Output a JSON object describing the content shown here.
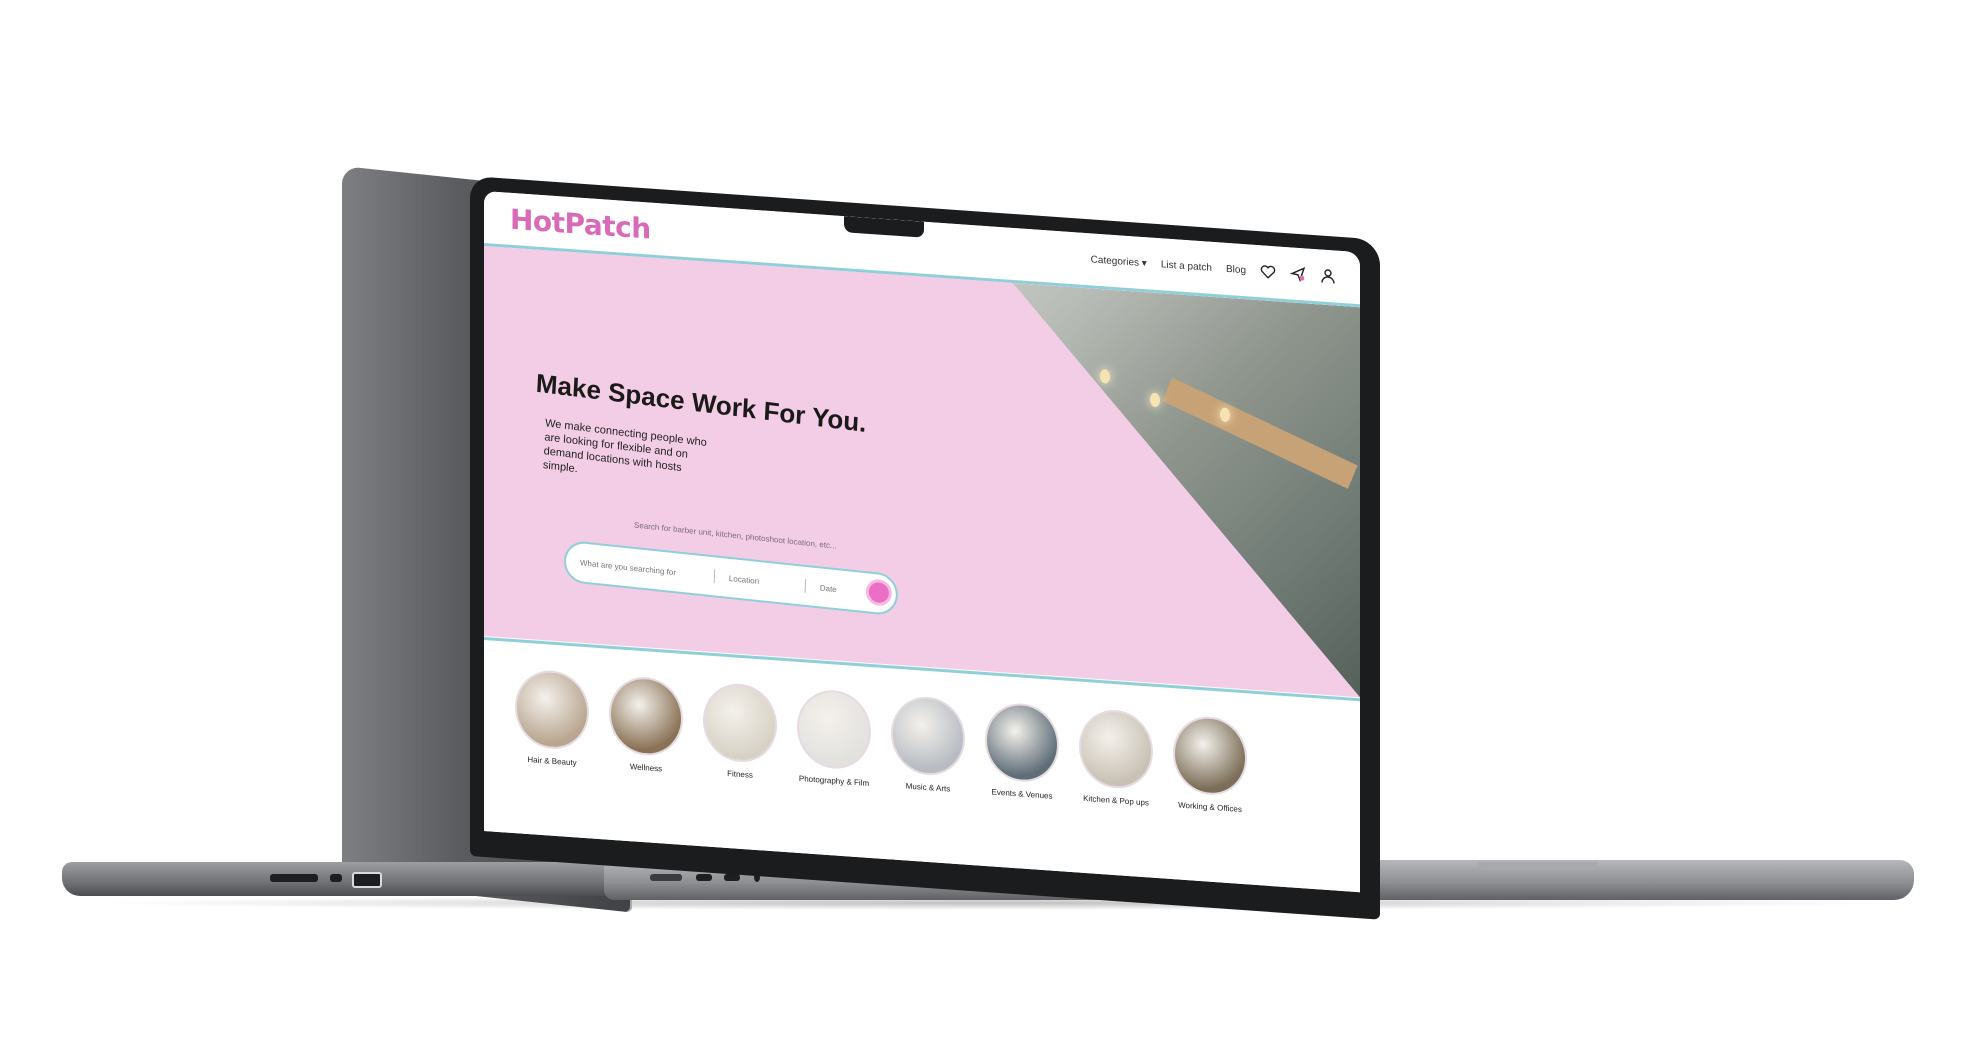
{
  "brand": {
    "logo": "HotPatch",
    "accent": "#d96ab8",
    "hero_bg": "#f3cde6",
    "border": "#8fd0d8"
  },
  "nav": {
    "categories": "Categories",
    "list_patch": "List a patch",
    "blog": "Blog",
    "icons": [
      "heart-icon",
      "send-icon",
      "user-icon"
    ]
  },
  "hero": {
    "title": "Make Space Work For You.",
    "subtitle": "We make connecting people who are looking for flexible and on demand locations with hosts simple.",
    "search_hint": "Search for barber unit, kitchen, photoshoot location, etc...",
    "search": {
      "what_placeholder": "What are you searching for",
      "location_placeholder": "Location",
      "date_placeholder": "Date"
    }
  },
  "categories": [
    {
      "label": "Hair & Beauty",
      "color": "#b9a690"
    },
    {
      "label": "Wellness",
      "color": "#8a7256"
    },
    {
      "label": "Fitness",
      "color": "#d8d2c6"
    },
    {
      "label": "Photography & Film",
      "color": "#e3e1de"
    },
    {
      "label": "Music & Arts",
      "color": "#b7bcc3"
    },
    {
      "label": "Events & Venues",
      "color": "#5f6d78"
    },
    {
      "label": "Kitchen & Pop ups",
      "color": "#c9c1b4"
    },
    {
      "label": "Working & Offices",
      "color": "#7b6e58"
    }
  ]
}
